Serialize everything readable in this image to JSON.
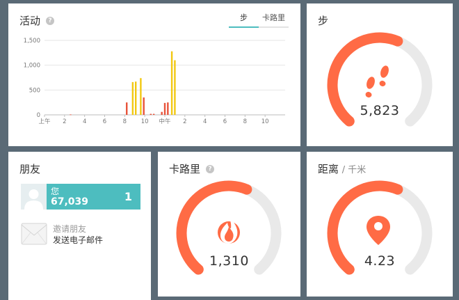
{
  "colors": {
    "background": "#5a6a76",
    "accent": "#ff6b45",
    "gauge_track": "#e9e9e9",
    "teal": "#4dbdbf",
    "bar_yellow": "#f2c811",
    "bar_red": "#e8533a"
  },
  "activity": {
    "title": "活动",
    "help_icon": "question-icon",
    "tabs": [
      {
        "label": "步",
        "active": true
      },
      {
        "label": "卡路里",
        "active": false
      }
    ],
    "chart_data": {
      "type": "bar",
      "ylim": [
        0,
        1500
      ],
      "y_ticks": [
        "0",
        "500",
        "1,000",
        "1,500"
      ],
      "y_tick_values": [
        0,
        500,
        1000,
        1500
      ],
      "x_tick_labels": [
        "上午",
        "2",
        "4",
        "6",
        "8",
        "10",
        "中午",
        "2",
        "4",
        "6",
        "8",
        "10"
      ],
      "x_tick_hours": [
        0,
        2,
        4,
        6,
        8,
        10,
        12,
        14,
        16,
        18,
        20,
        22
      ],
      "x_range_hours": [
        0,
        24
      ],
      "grid": true,
      "bars": [
        {
          "hour": 2.6,
          "value": 8,
          "color": "#e8533a"
        },
        {
          "hour": 8.2,
          "value": 250,
          "color": "#e8533a"
        },
        {
          "hour": 8.8,
          "value": 660,
          "color": "#f2c811"
        },
        {
          "hour": 9.1,
          "value": 670,
          "color": "#f2c811"
        },
        {
          "hour": 9.6,
          "value": 740,
          "color": "#f2c811"
        },
        {
          "hour": 9.9,
          "value": 350,
          "color": "#e8533a"
        },
        {
          "hour": 10.6,
          "value": 20,
          "color": "#e8533a"
        },
        {
          "hour": 10.9,
          "value": 20,
          "color": "#e8533a"
        },
        {
          "hour": 11.7,
          "value": 60,
          "color": "#e8533a"
        },
        {
          "hour": 12.0,
          "value": 240,
          "color": "#e8533a"
        },
        {
          "hour": 12.3,
          "value": 250,
          "color": "#e8533a"
        },
        {
          "hour": 12.7,
          "value": 1280,
          "color": "#f2c811"
        },
        {
          "hour": 13.0,
          "value": 1100,
          "color": "#f2c811"
        }
      ]
    }
  },
  "steps": {
    "title": "步",
    "value": "5,823",
    "progress": 0.58,
    "icon": "footprints-icon"
  },
  "friends": {
    "title": "朋友",
    "me": {
      "name": "您",
      "steps": "67,039",
      "rank": "1",
      "avatar": "avatar-icon"
    },
    "invite": {
      "title": "邀请朋友",
      "action": "发送电子邮件",
      "icon": "envelope-icon"
    }
  },
  "calories": {
    "title": "卡路里",
    "help_icon": "question-icon",
    "value": "1,310",
    "progress": 0.58,
    "icon": "flame-icon"
  },
  "distance": {
    "title": "距离",
    "unit": "/ 千米",
    "value": "4.23",
    "progress": 0.58,
    "icon": "map-pin-icon"
  }
}
